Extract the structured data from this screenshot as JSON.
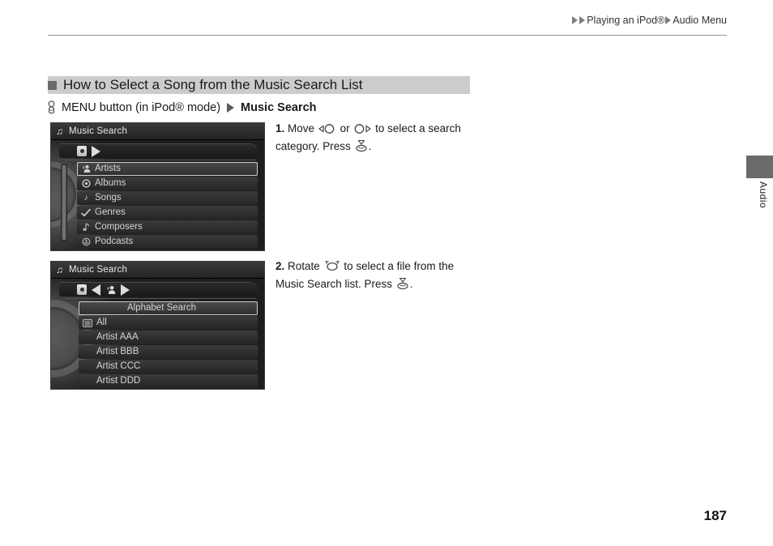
{
  "header": {
    "breadcrumb": [
      {
        "label": "Playing an iPod®"
      },
      {
        "label": "Audio Menu"
      }
    ]
  },
  "section": {
    "title": "How to Select a Song from the Music Search List",
    "path": {
      "knob_icon": "menu-knob-icon",
      "text": "MENU button (in iPod® mode)",
      "target": "Music Search"
    }
  },
  "screens": [
    {
      "id": "screen-music-search-categories",
      "titlebar": {
        "icon": "music-note-icon",
        "title": "Music Search"
      },
      "tabs": [
        {
          "icon": "ipod-source-icon"
        },
        {
          "icon": "arrow-right-icon"
        }
      ],
      "scrollbar": true,
      "rows": [
        {
          "icon": "artists-icon",
          "label": "Artists",
          "selected": true
        },
        {
          "icon": "albums-icon",
          "label": "Albums",
          "selected": false
        },
        {
          "icon": "songs-icon",
          "label": "Songs",
          "selected": false
        },
        {
          "icon": "genres-icon",
          "label": "Genres",
          "selected": false
        },
        {
          "icon": "composers-icon",
          "label": "Composers",
          "selected": false
        },
        {
          "icon": "podcasts-icon",
          "label": "Podcasts",
          "selected": false
        }
      ]
    },
    {
      "id": "screen-artist-list",
      "titlebar": {
        "icon": "music-note-icon",
        "title": "Music Search"
      },
      "tabs": [
        {
          "icon": "ipod-source-icon"
        },
        {
          "icon": "arrow-left-icon"
        },
        {
          "icon": "artists-icon"
        },
        {
          "icon": "arrow-right-icon"
        }
      ],
      "scrollbar": false,
      "rows": [
        {
          "icon": null,
          "label": "Alphabet Search",
          "selected": true,
          "centered": true
        },
        {
          "icon": "all-list-icon",
          "label": "All",
          "selected": false
        },
        {
          "icon": null,
          "label": "Artist AAA",
          "selected": false
        },
        {
          "icon": null,
          "label": "Artist BBB",
          "selected": false
        },
        {
          "icon": null,
          "label": "Artist CCC",
          "selected": false
        },
        {
          "icon": null,
          "label": "Artist DDD",
          "selected": false
        }
      ]
    }
  ],
  "steps": [
    {
      "number": "1.",
      "part1": "Move",
      "icon1": "joystick-left-icon",
      "part2": "or",
      "icon2": "joystick-right-icon",
      "part3": "to select a search category. Press",
      "icon3": "enter-knob-icon",
      "part4": "."
    },
    {
      "number": "2.",
      "part1": "Rotate",
      "icon1": "rotate-knob-icon",
      "part2": "",
      "icon2": null,
      "part3": "to select a file from the Music Search list. Press",
      "icon3": "enter-knob-icon",
      "part4": "."
    }
  ],
  "side_tab": {
    "label": "Audio"
  },
  "page_number": "187",
  "colors": {
    "band": "#cccccc",
    "bullet": "#6b6b6b",
    "side_tab": "#6b6b6b",
    "screen_bg": "#1b1b1b",
    "row_text": "#d5d5d5"
  }
}
